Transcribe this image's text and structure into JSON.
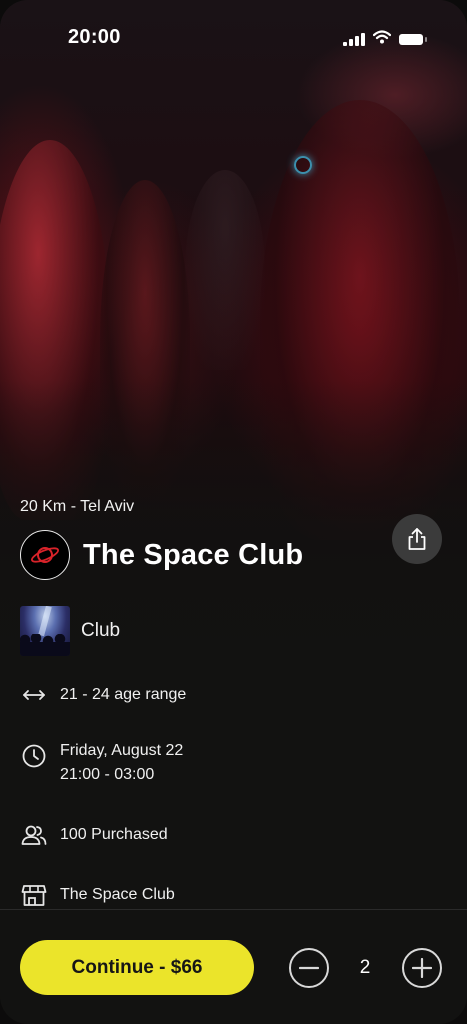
{
  "status_bar": {
    "time": "20:00",
    "icons": [
      "signal-icon",
      "wifi-icon",
      "battery-icon"
    ]
  },
  "event": {
    "distance": "20 Km - Tel Aviv",
    "title": "The Space Club",
    "logo_icon": "planet-logo-icon",
    "share_icon": "share-icon",
    "type_label": "Club",
    "age_range": "21 - 24 age range",
    "date": "Friday, August 22",
    "time_range": "21:00 - 03:00",
    "purchased": "100 Purchased",
    "venue": "The Space Club"
  },
  "footer": {
    "continue_label": "Continue - $66",
    "quantity": "2",
    "minus_icon": "minus-circle-icon",
    "plus_icon": "plus-circle-icon"
  },
  "colors": {
    "accent": "#ebe42a",
    "background": "#121211",
    "share_button": "#3b3b3b",
    "logo_red": "#d8232a"
  }
}
